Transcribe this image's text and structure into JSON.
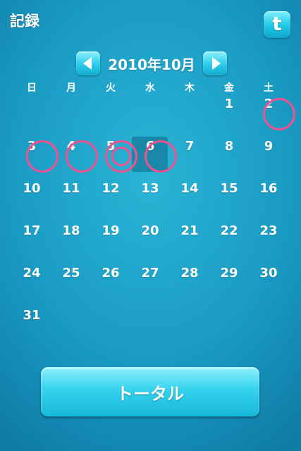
{
  "header": {
    "title": "記録",
    "share_icon": "t-share-icon"
  },
  "calendar": {
    "month_label": "2010年10月",
    "weekdays": [
      "日",
      "月",
      "火",
      "水",
      "木",
      "金",
      "土"
    ],
    "days": [
      "1",
      "2",
      "3",
      "4",
      "5",
      "6",
      "7",
      "8",
      "9",
      "10",
      "11",
      "12",
      "13",
      "14",
      "15",
      "16",
      "17",
      "18",
      "19",
      "20",
      "21",
      "22",
      "23",
      "24",
      "25",
      "26",
      "27",
      "28",
      "29",
      "30",
      "31"
    ],
    "today": "6",
    "marked_days": [
      "2",
      "3",
      "4",
      "5",
      "6"
    ],
    "double_marked_days": [
      "5"
    ]
  },
  "footer": {
    "total_label": "トータル"
  },
  "colors": {
    "accent": "#2ab4d6",
    "mark": "#f0518f",
    "button": "#36d2ee"
  }
}
